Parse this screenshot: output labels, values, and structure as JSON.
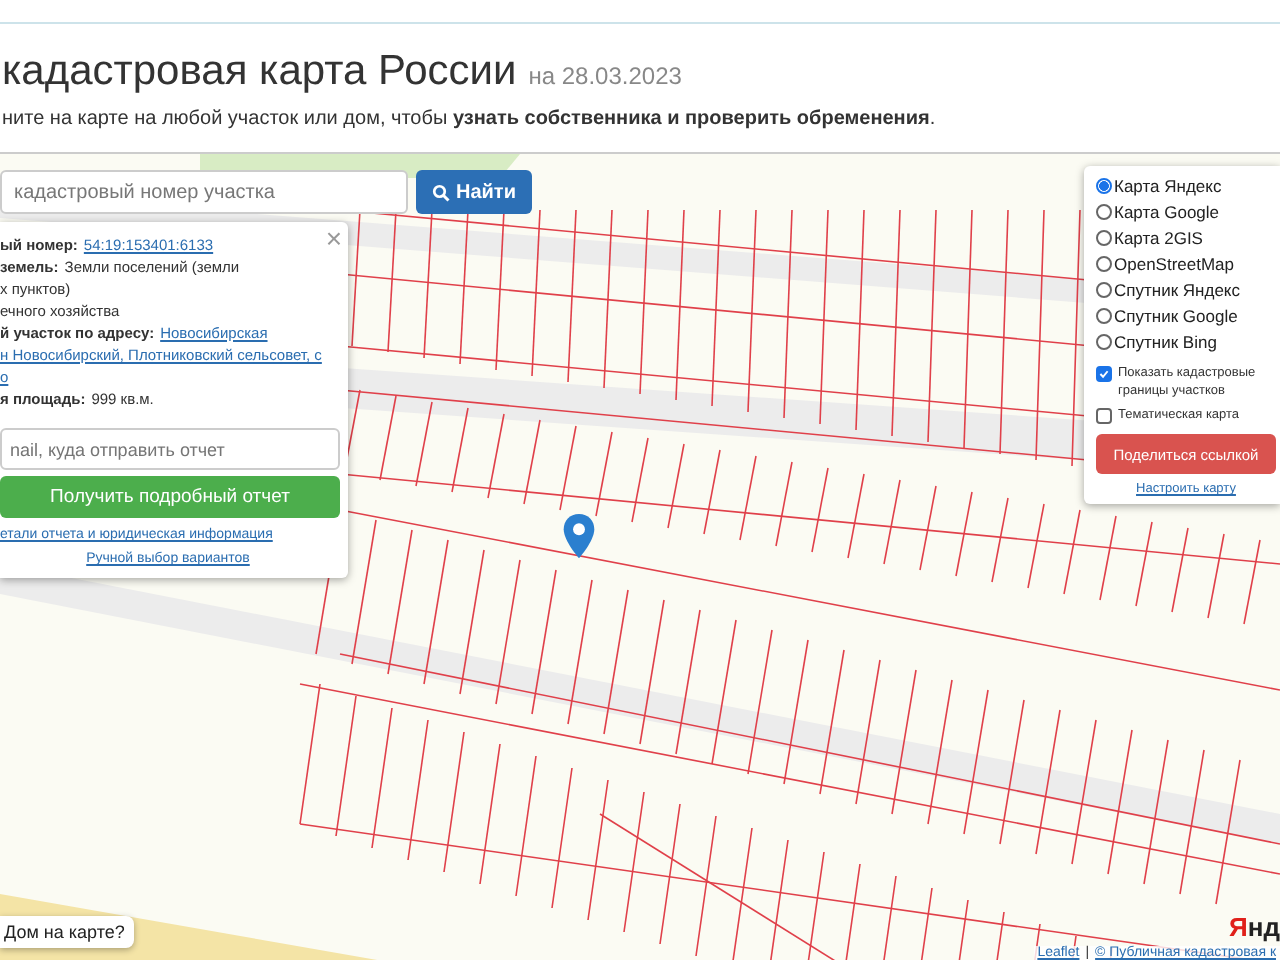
{
  "header": {
    "title": "кадастровая карта России",
    "date": "на 28.03.2023",
    "subtitle": "ните на карте на любой участок или дом, чтобы **узнать собственника и проверить обременения**."
  },
  "search": {
    "placeholder": "кадастровый номер участка",
    "button": "Найти"
  },
  "popup": {
    "close": "×",
    "lines": [
      {
        "parts": [
          {
            "text": "ый номер:",
            "kind": "label"
          },
          {
            "text": "54:19:153401:6133",
            "kind": "link"
          }
        ]
      },
      {
        "parts": [
          {
            "text": "земель:",
            "kind": "label"
          },
          {
            "text": "Земли поселений (земли",
            "kind": "plain"
          }
        ]
      },
      {
        "parts": [
          {
            "text": "х пунктов)",
            "kind": "plain"
          }
        ]
      },
      {
        "parts": [
          {
            "text": "ечного хозяйства",
            "kind": "plain"
          }
        ]
      },
      {
        "parts": [
          {
            "text": "й участок по адресу:",
            "kind": "label"
          },
          {
            "text": "Новосибирская",
            "kind": "link"
          }
        ]
      },
      {
        "parts": [
          {
            "text": "н Новосибирский, Плотниковский сельсовет, с",
            "kind": "link"
          }
        ]
      },
      {
        "parts": [
          {
            "text": "о",
            "kind": "link"
          }
        ]
      },
      {
        "parts": [
          {
            "text": "я площадь:",
            "kind": "label"
          },
          {
            "text": "999 кв.м.",
            "kind": "plain"
          }
        ]
      }
    ],
    "email_placeholder": "nail, куда отправить отчет",
    "report_button": "Получить подробный отчет",
    "details_link": "етали отчета и юридическая информация",
    "manual_link": "Ручной выбор вариантов"
  },
  "layers": {
    "maps": [
      {
        "label": "Карта Яндекс",
        "selected": true
      },
      {
        "label": "Карта Google",
        "selected": false
      },
      {
        "label": "Карта 2GIS",
        "selected": false
      },
      {
        "label": "OpenStreetMap",
        "selected": false
      },
      {
        "label": "Спутник Яндекс",
        "selected": false
      },
      {
        "label": "Спутник Google",
        "selected": false
      },
      {
        "label": "Спутник Bing",
        "selected": false
      }
    ],
    "options": [
      {
        "label": "Показать кадастровые границы участков",
        "checked": true
      },
      {
        "label": "Тематическая карта",
        "checked": false
      }
    ],
    "share_button": "Поделиться ссылкой",
    "settings_link": "Настроить карту"
  },
  "house_prompt": "Дом на карте?",
  "attribution": {
    "leaflet": "Leaflet",
    "separator": "|",
    "source": "© Публичная кадастровая к"
  },
  "map_logo": "Янд"
}
